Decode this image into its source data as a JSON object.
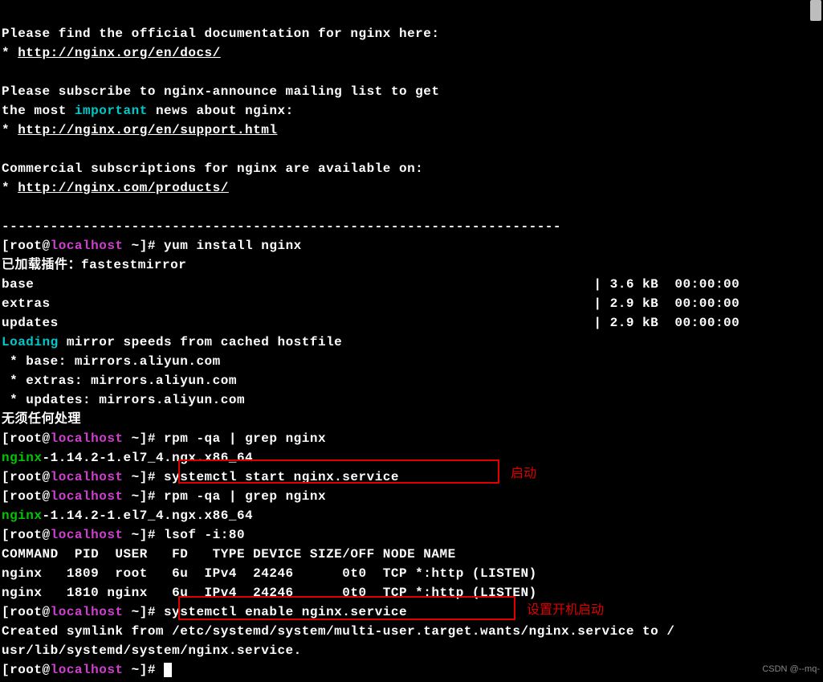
{
  "intro": {
    "docs_line": "Please find the official documentation for nginx here:",
    "star": "* ",
    "docs_url": "http://nginx.org/en/docs/",
    "sub_l1_a": "Please subscribe to nginx-announce mailing list to get",
    "sub_l2_a": "the most ",
    "sub_l2_b": "important",
    "sub_l2_c": " news about nginx:",
    "support_url": "http://nginx.org/en/support.html",
    "commercial": "Commercial subscriptions for nginx are available on:",
    "products_url": "http://nginx.com/products/"
  },
  "hr": "---------------------------------------------------------------------",
  "prompt": {
    "open": "[root@",
    "host": "localhost",
    "close": " ~]# "
  },
  "cmds": {
    "yum": "yum install nginx",
    "plugins": "已加载插件：fastestmirror",
    "rpm": "rpm -qa | grep nginx",
    "start": "systemctl start nginx.service",
    "lsof": "lsof -i:80",
    "enable": "systemctl enable nginx.service"
  },
  "repos": {
    "base": "base                                                                     | 3.6 kB  00:00:00",
    "extras": "extras                                                                   | 2.9 kB  00:00:00",
    "updates": "updates                                                                  | 2.9 kB  00:00:00"
  },
  "mirror": {
    "loading": "Loading",
    "rest": " mirror speeds from cached hostfile",
    "base": " * base: mirrors.aliyun.com",
    "extras": " * extras: mirrors.aliyun.com",
    "updates": " * updates: mirrors.aliyun.com",
    "none": "无须任何处理"
  },
  "pkg": {
    "name": "nginx",
    "rest": "-1.14.2-1.el7_4.ngx.x86_64"
  },
  "lsof_out": {
    "hdr": "COMMAND  PID  USER   FD   TYPE DEVICE SIZE/OFF NODE NAME",
    "r1": "nginx   1809  root   6u  IPv4  24246      0t0  TCP *:http (LISTEN)",
    "r2": "nginx   1810 nginx   6u  IPv4  24246      0t0  TCP *:http (LISTEN)"
  },
  "symlink": {
    "l1": "Created symlink from /etc/systemd/system/multi-user.target.wants/nginx.service to /",
    "l2": "usr/lib/systemd/system/nginx.service."
  },
  "annotations": {
    "start": "启动",
    "enable": "设置开机启动"
  },
  "watermark": "CSDN @--mq-"
}
